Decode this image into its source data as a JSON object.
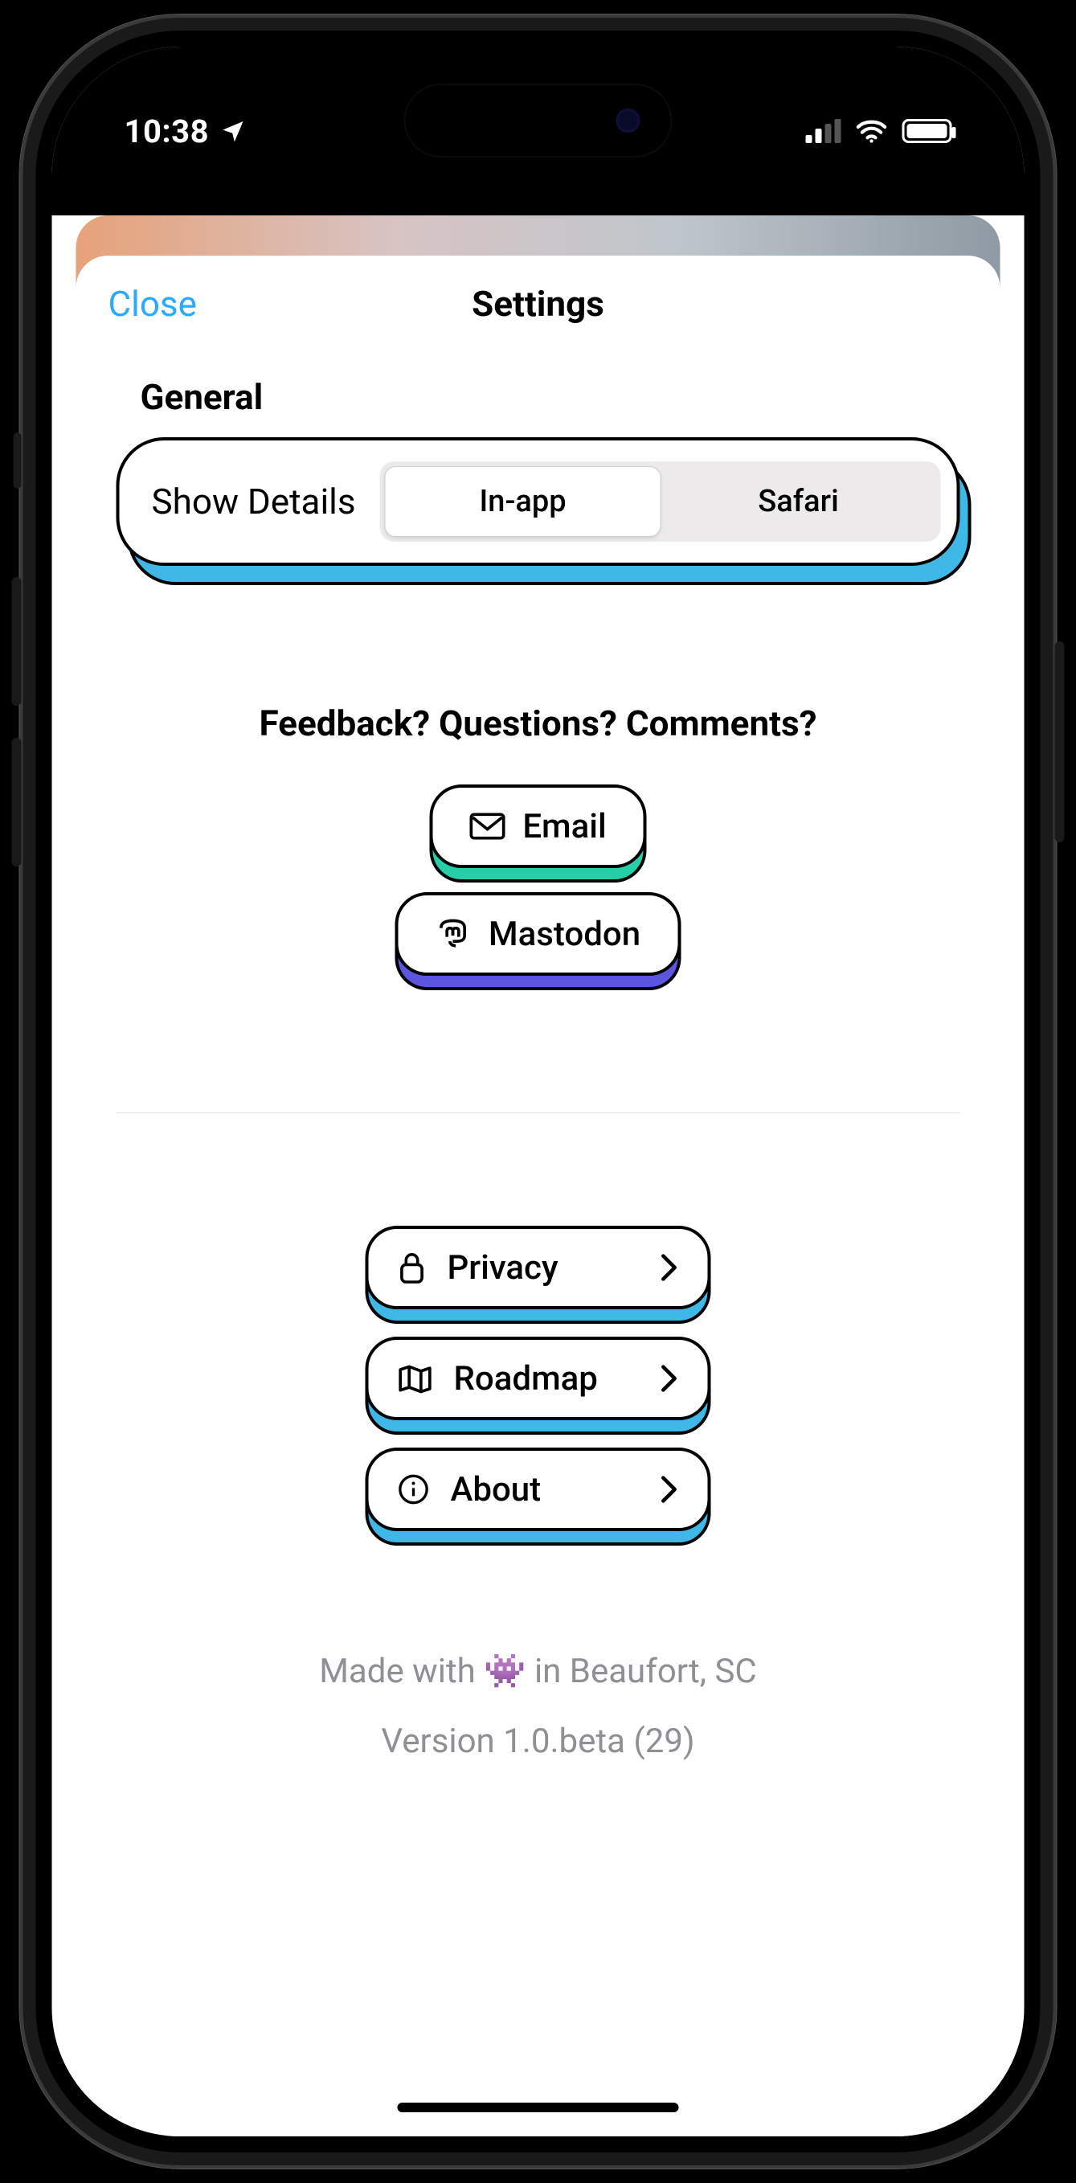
{
  "status": {
    "time": "10:38"
  },
  "nav": {
    "close": "Close",
    "title": "Settings"
  },
  "general": {
    "heading": "General",
    "show_details_label": "Show Details",
    "segments": {
      "in_app": "In-app",
      "safari": "Safari"
    }
  },
  "feedback": {
    "heading": "Feedback? Questions? Comments?",
    "email": "Email",
    "mastodon": "Mastodon"
  },
  "links": {
    "privacy": "Privacy",
    "roadmap": "Roadmap",
    "about": "About"
  },
  "footer": {
    "made_with_prefix": "Made with ",
    "made_with_suffix": " in Beaufort, SC",
    "version": "Version 1.0.beta (29)"
  }
}
